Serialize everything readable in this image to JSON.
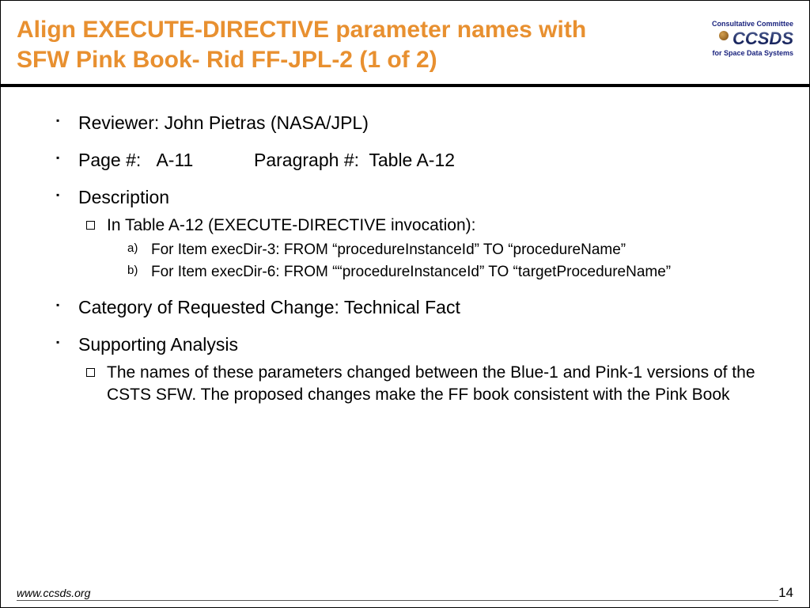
{
  "header": {
    "title": "Align EXECUTE-DIRECTIVE parameter names with SFW Pink Book- Rid FF-JPL-2 (1 of 2)",
    "logo": {
      "line1": "Consultative Committee",
      "main": "CCSDS",
      "line2": "for Space Data Systems"
    }
  },
  "bullets": {
    "reviewer": "Reviewer: John Pietras (NASA/JPL)",
    "page_para": "Page #:   A-11            Paragraph #:  Table A-12",
    "description_label": "Description",
    "desc_sub": "In Table A-12 (EXECUTE-DIRECTIVE invocation):",
    "desc_a": "For Item execDir-3: FROM “procedureInstanceId” TO “procedureName”",
    "desc_b": "For Item execDir-6: FROM ““procedureInstanceId” TO “targetProcedureName”",
    "category": "Category of Requested Change: Technical Fact",
    "supporting_label": "Supporting Analysis",
    "supporting_sub": "The names of these parameters changed between the Blue-1 and Pink-1 versions of the CSTS SFW. The proposed changes make the FF book consistent with the Pink Book"
  },
  "footer": {
    "url": "www.ccsds.org",
    "page": "14"
  }
}
